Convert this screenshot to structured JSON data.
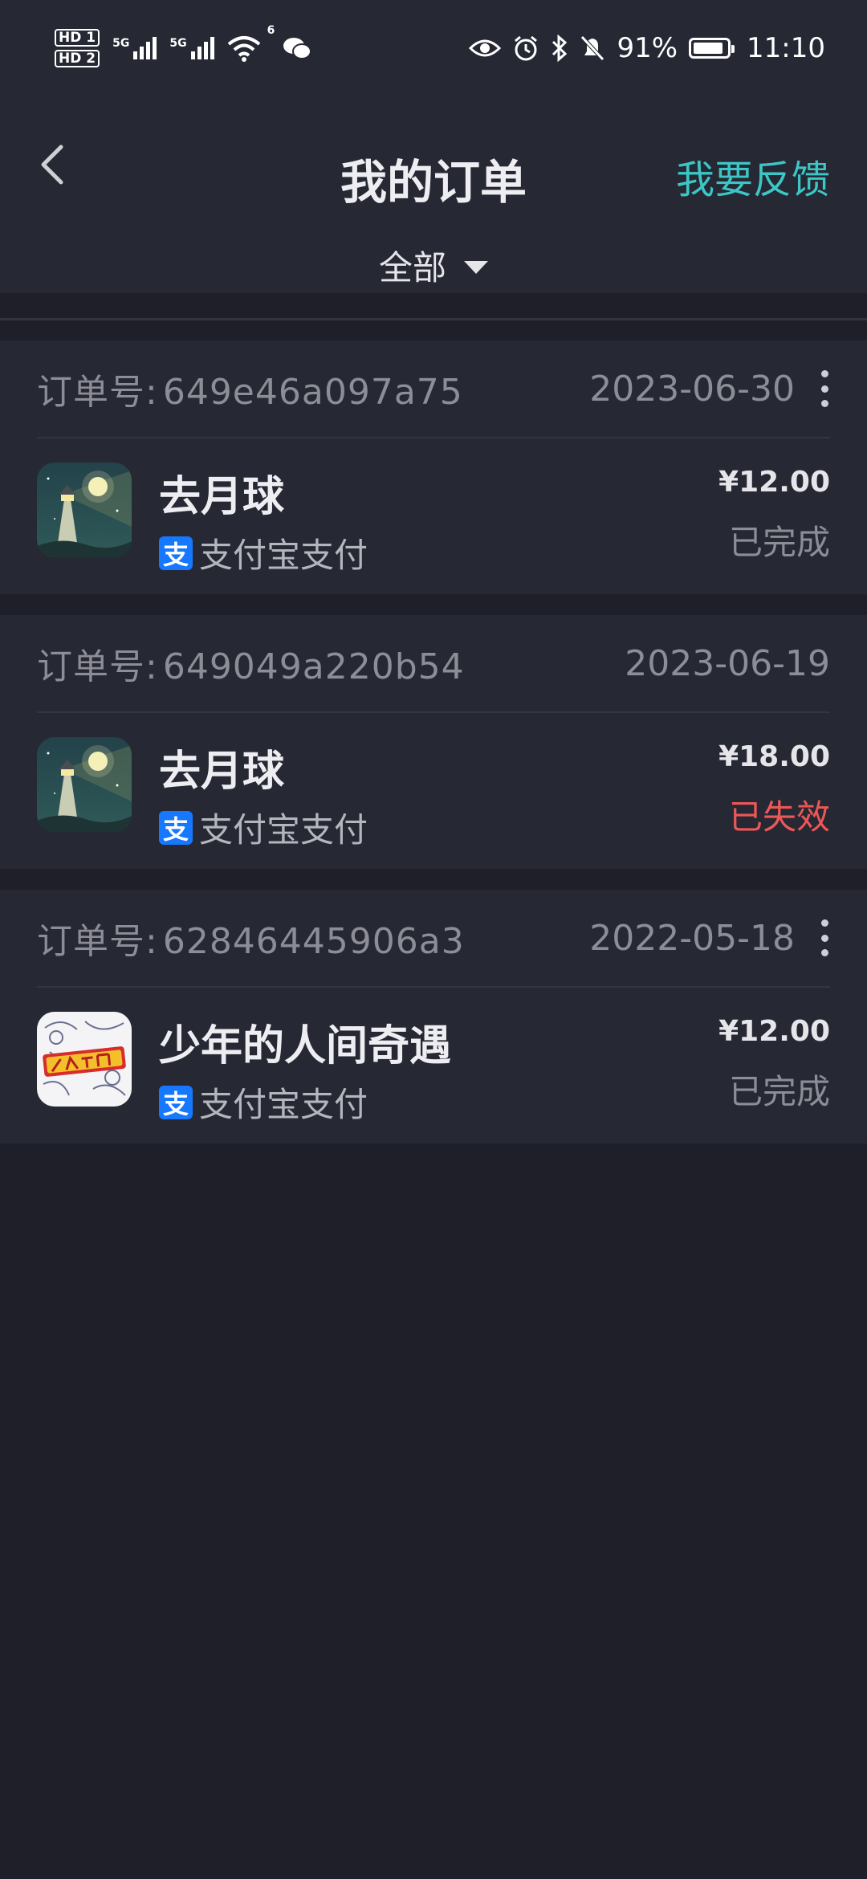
{
  "status_bar": {
    "sim1_label": "HD 1",
    "sim2_label": "HD 2",
    "net1": "5G",
    "net2": "5G",
    "wifi_label": "6",
    "battery": "91%",
    "battery_level": 0.91,
    "time": "11:10",
    "icons": [
      "eye-icon",
      "alarm-icon",
      "bluetooth-icon",
      "bell-off-icon",
      "wechat-icon"
    ]
  },
  "header": {
    "title": "我的订单",
    "feedback": "我要反馈",
    "filter": "全部"
  },
  "colors": {
    "accent": "#3cc6c6",
    "error": "#ee5757",
    "alipay": "#1677ff",
    "background": "#1e1f28",
    "card": "#262833"
  },
  "orders": [
    {
      "order_label": "订单号:",
      "order_no": "649e46a097a75",
      "date": "2023-06-30",
      "has_more": true,
      "name": "去月球",
      "payment": "支付宝支付",
      "price": "¥12.00",
      "status": "已完成",
      "icon": "lighthouse-app-icon"
    },
    {
      "order_label": "订单号:",
      "order_no": "649049a220b54",
      "date": "2023-06-19",
      "has_more": false,
      "name": "去月球",
      "payment": "支付宝支付",
      "price": "¥18.00",
      "status": "已失效",
      "icon": "lighthouse-app-icon"
    },
    {
      "order_label": "订单号:",
      "order_no": "62846445906a3",
      "date": "2022-05-18",
      "has_more": true,
      "name": "少年的人间奇遇",
      "payment": "支付宝支付",
      "price": "¥12.00",
      "status": "已完成",
      "icon": "comic-app-icon"
    }
  ]
}
